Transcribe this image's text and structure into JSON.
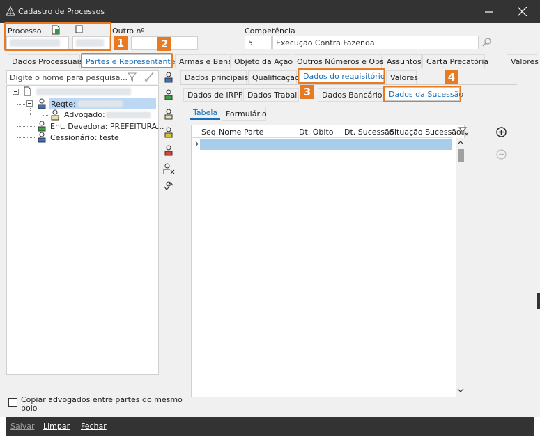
{
  "window": {
    "title": "Cadastro de Processos",
    "minimize_glyph": "—",
    "close_glyph": "✕"
  },
  "header": {
    "processo_label": "Processo",
    "outro_label": "Outro nº",
    "competencia_label": "Competência",
    "competencia_code": "5",
    "competencia_value": "Execução Contra Fazenda"
  },
  "main_tabs": [
    "Dados Processuais",
    "Partes e Representantes",
    "Armas e Bens",
    "Objeto da Ação",
    "Outros Números e Obs.",
    "Assuntos",
    "Carta Precatória",
    "Valores"
  ],
  "search": {
    "placeholder": "Digite o nome para pesquisa..."
  },
  "tree": {
    "reqte_label": "Reqte:",
    "advogado_label": "Advogado:",
    "ent_devedora_label": "Ent. Devedora: PREFEITURA...",
    "cessionario_label": "Cessionário: teste"
  },
  "sub_tabs_row1": [
    "Dados principais",
    "Qualificação",
    "Dados do requisitório",
    "Valores"
  ],
  "sub_tabs_row2": [
    "Dados de IRPF",
    "Dados Trabalh",
    "Dados Bancários",
    "Dados da Sucessão"
  ],
  "view_tabs": [
    "Tabela",
    "Formulário"
  ],
  "grid": {
    "columns": [
      "Seq.",
      "Nome Parte",
      "Dt. Óbito",
      "Dt. Sucessão",
      "Situação Sucessão"
    ]
  },
  "footer": {
    "copy_label_line1": "Copiar advogados entre partes do mesmo",
    "copy_label_line2": "polo",
    "salvar": "Salvar",
    "limpar": "Limpar",
    "fechar": "Fechar"
  },
  "callouts": [
    "1",
    "2",
    "3",
    "4"
  ],
  "colors": {
    "accent": "#e87a22",
    "active_tab_text": "#1a6fb8",
    "selection": "#bcd8f3",
    "titlebar": "#333333"
  }
}
